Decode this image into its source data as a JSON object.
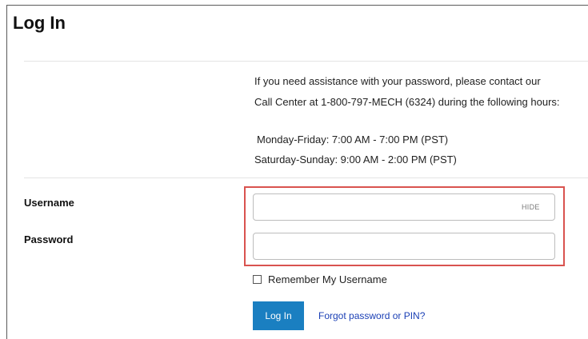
{
  "page": {
    "title": "Log In"
  },
  "assistance": {
    "line1": "If you need assistance with your password, please contact our",
    "line2": "Call Center at 1-800-797-MECH (6324) during the following hours:",
    "hours_weekday": "Monday-Friday: 7:00 AM - 7:00 PM (PST)",
    "hours_weekend": "Saturday-Sunday: 9:00 AM - 2:00 PM (PST)"
  },
  "form": {
    "username_label": "Username",
    "username_value": "",
    "hide_label": "HIDE",
    "password_label": "Password",
    "password_value": "",
    "remember_label": "Remember My Username",
    "remember_checked": false,
    "login_button": "Log In",
    "forgot_link": "Forgot password or PIN?"
  },
  "colors": {
    "highlight": "#d9534f",
    "primary_button": "#1a7fc1",
    "link": "#1a3fb5"
  }
}
